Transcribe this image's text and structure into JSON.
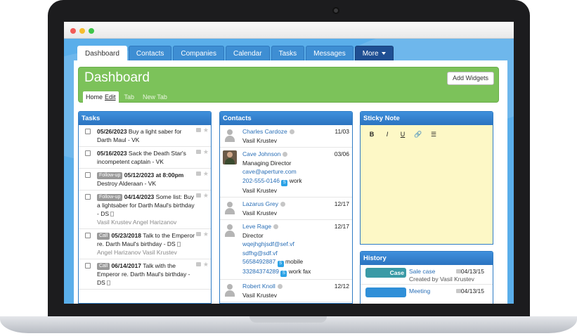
{
  "nav": {
    "tabs": [
      "Dashboard",
      "Contacts",
      "Companies",
      "Calendar",
      "Tasks",
      "Messages"
    ],
    "more_label": "More"
  },
  "dashboard": {
    "title": "Dashboard",
    "add_widgets_label": "Add Widgets",
    "subtabs": {
      "home": "Home",
      "edit": "Edit",
      "tab": "Tab",
      "new_tab": "New Tab"
    }
  },
  "tasks": {
    "title": "Tasks",
    "items": [
      {
        "badge": "",
        "date": "05/26/2023",
        "text": "Buy a light saber for Darth Maul",
        "suffix": " - VK",
        "people": ""
      },
      {
        "badge": "",
        "date": "05/16/2023",
        "text": "Sack the Death Star's incompetent captain",
        "suffix": " - VK",
        "people": ""
      },
      {
        "badge": "Follow-up",
        "date": "05/12/2023 at 8:00pm",
        "text": "Destroy Alderaan",
        "suffix": " - VK",
        "people": ""
      },
      {
        "badge": "Follow-up",
        "date": "04/14/2023",
        "text": "Some list: Buy a lightsaber for Darth Maul's birthday",
        "suffix": " - DS",
        "people": "Vasil Krustev Angel Harizanov"
      },
      {
        "badge": "Call",
        "date": "05/23/2018",
        "text": "Talk to the Emperor re. Darth Maul's birthday",
        "suffix": " - DS",
        "people": "Angel Harizanov Vasil Krustev"
      },
      {
        "badge": "Call",
        "date": "06/14/2017",
        "text": "Talk with the Emperor re. Darth Maul's birthday",
        "suffix": " - DS",
        "people": ""
      }
    ]
  },
  "contacts": {
    "title": "Contacts",
    "items": [
      {
        "name": "Charles Cardoze",
        "date": "11/03",
        "lines": [
          "Vasil Krustev"
        ]
      },
      {
        "name": "Cave Johnson",
        "date": "03/06",
        "title": "Managing Director",
        "email": "cave@aperture.com",
        "phone": "202-555-0146",
        "phone_type": "work",
        "owner": "Vasil Krustev"
      },
      {
        "name": "Lazarus Grey",
        "date": "12/17",
        "lines": [
          "Vasil Krustev"
        ]
      },
      {
        "name": "Leve Rage",
        "date": "12/17",
        "title": "Director",
        "emails": [
          "wqejhghjsdf@sef.vf",
          "sdfhg@sdf.vf"
        ],
        "phone1": "5658492887",
        "phone1_type": "mobile",
        "phone2": "33284374289",
        "phone2_type": "work fax"
      },
      {
        "name": "Robert Knoll",
        "date": "12/12",
        "lines": [
          "Vasil Krustev"
        ]
      }
    ]
  },
  "sticky": {
    "title": "Sticky Note",
    "toolbar": [
      "B",
      "I",
      "U",
      "🔗",
      "☰"
    ]
  },
  "history": {
    "title": "History",
    "items": [
      {
        "badge": "Case",
        "text": "Sale case",
        "sub": "Created by Vasil Krustev",
        "date": "04/13/15"
      },
      {
        "badge": "",
        "text": "Meeting",
        "sub": "",
        "date": "04/13/15"
      }
    ]
  }
}
